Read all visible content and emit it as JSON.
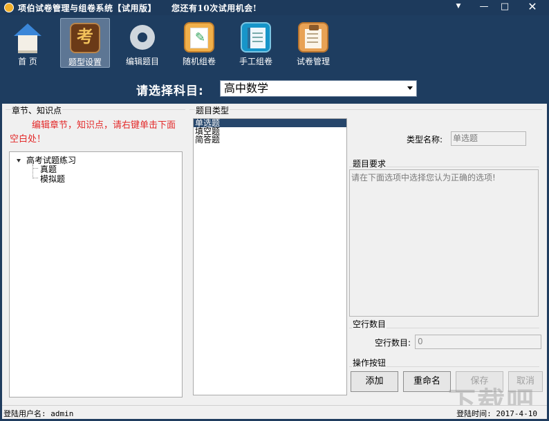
{
  "window": {
    "title": "项伯试卷管理与组卷系统【试用版】",
    "trial_notice": "您还有10次试用机会!",
    "controls": {
      "menu": "▼",
      "minimize": "—",
      "maximize": "□",
      "close": "✕"
    }
  },
  "toolbar": {
    "items": [
      {
        "label": "首  页",
        "icon": "house-icon"
      },
      {
        "label": "题型设置",
        "icon": "kao-icon",
        "active": true,
        "glyph": "考"
      },
      {
        "label": "编辑题目",
        "icon": "gear-icon"
      },
      {
        "label": "随机组卷",
        "icon": "paper-pen-icon"
      },
      {
        "label": "手工组卷",
        "icon": "notebook-icon"
      },
      {
        "label": "试卷管理",
        "icon": "clipboard-icon"
      }
    ]
  },
  "subject": {
    "label": "请选择科目:",
    "selected": "高中数学"
  },
  "chapters": {
    "title": "章节、知识点",
    "hint": "编辑章节，知识点，请右键单击下面空白处！",
    "tree": {
      "root": "高考试题练习",
      "children": [
        "真题",
        "模拟题"
      ]
    }
  },
  "question_types": {
    "title": "题目类型",
    "items": [
      "单选题",
      "填空题",
      "简答题"
    ],
    "selected_index": 0
  },
  "detail": {
    "type_name_label": "类型名称:",
    "type_name_value": "单选题",
    "requirement_title": "题目要求",
    "requirement_text": "请在下面选项中选择您认为正确的选项!",
    "blank_section_title": "空行数目",
    "blank_label": "空行数目:",
    "blank_value": "0",
    "actions_title": "操作按钮",
    "buttons": {
      "add": "添加",
      "rename": "重命名",
      "save": "保存",
      "cancel": "取消"
    }
  },
  "status": {
    "user": "登陆用户名: admin",
    "time": "登陆时间: 2017-4-10"
  },
  "watermark": "下载吧",
  "colors": {
    "titlebar": "#1d3a5c",
    "toolbar": "#1e3d60",
    "hint": "#e32a2a",
    "selection": "#26466b"
  }
}
